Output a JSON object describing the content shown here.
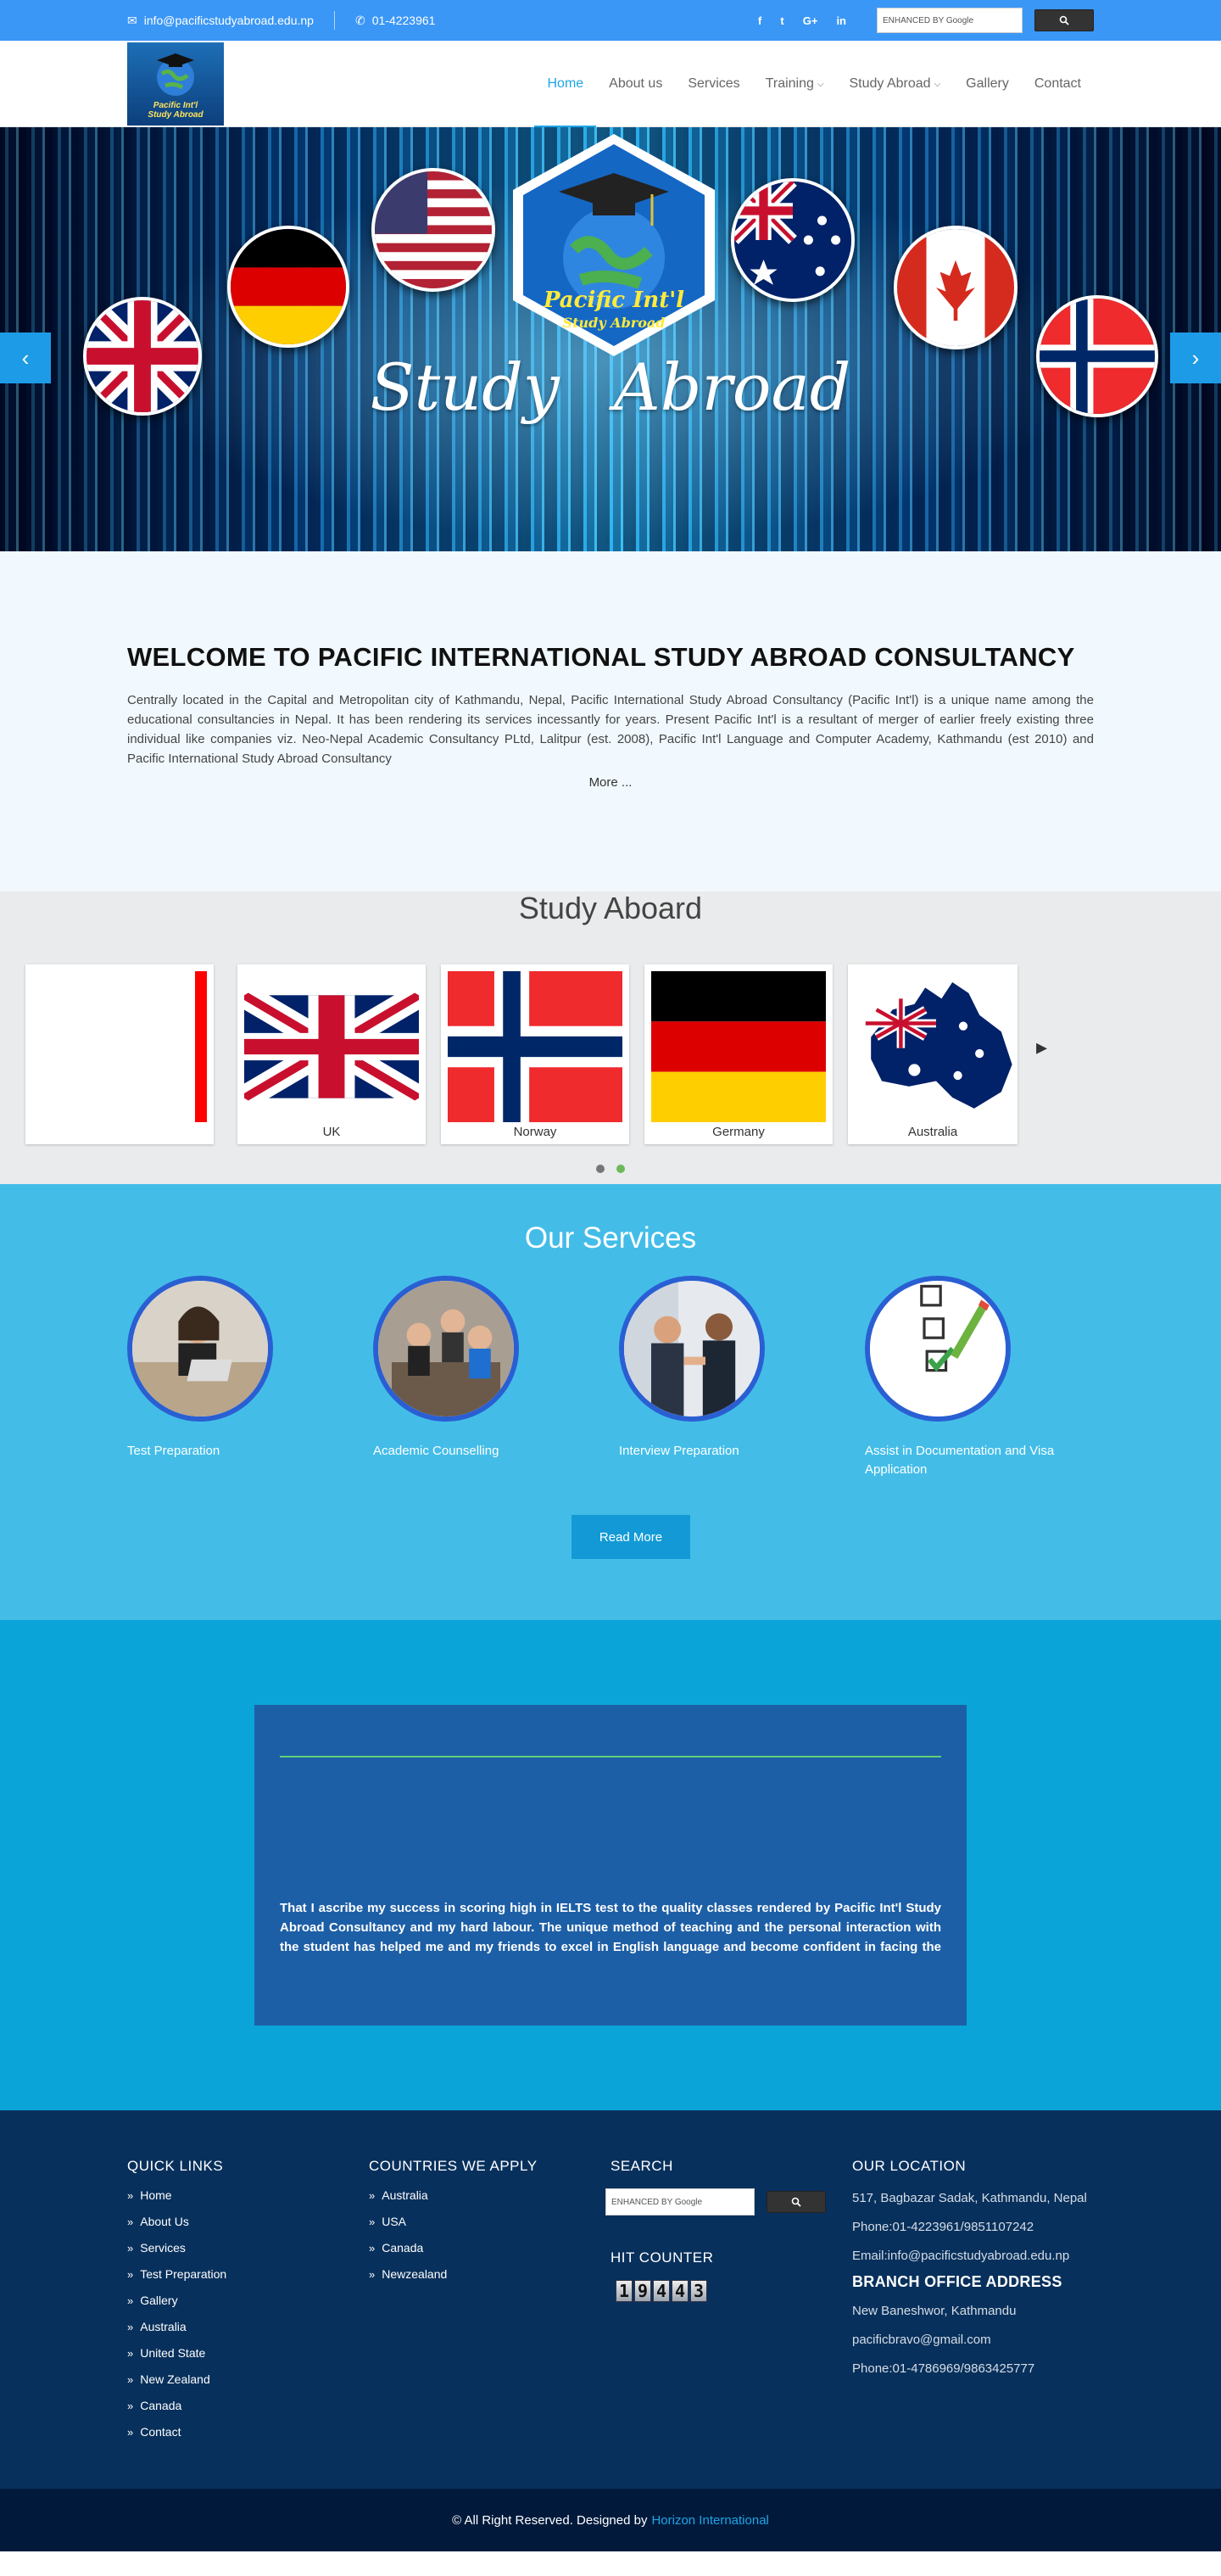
{
  "topbar": {
    "email": "info@pacificstudyabroad.edu.np",
    "phone": "01-4223961",
    "social": [
      "f",
      "t",
      "G+",
      "in"
    ],
    "search_placeholder": "ENHANCED BY Google"
  },
  "brand": {
    "name": "Pacific Int'l",
    "tagline": "Study Abroad"
  },
  "nav": {
    "items": [
      {
        "label": "Home",
        "active": true
      },
      {
        "label": "About us"
      },
      {
        "label": "Services"
      },
      {
        "label": "Training",
        "dropdown": true
      },
      {
        "label": "Study Abroad",
        "dropdown": true
      },
      {
        "label": "Gallery"
      },
      {
        "label": "Contact"
      }
    ]
  },
  "hero": {
    "title": "Study Abroad",
    "logo_line1": "Pacific Int'l",
    "logo_line2": "Study Abroad"
  },
  "welcome": {
    "title": "WELCOME TO PACIFIC INTERNATIONAL STUDY ABROAD CONSULTANCY",
    "body": "Centrally located in the Capital and Metropolitan city of Kathmandu, Nepal, Pacific International Study Abroad Consultancy (Pacific Int'l) is a unique name among the educational consultancies in Nepal. It has been rendering its services incessantly for years. Present Pacific Int'l is a resultant of merger of earlier freely existing three individual like companies viz. Neo-Nepal Academic Consultancy PLtd, Lalitpur (est. 2008), Pacific Int'l Language and Computer Academy, Kathmandu (est 2010) and Pacific International Study Abroad Consultancy",
    "more": "More ..."
  },
  "aboard": {
    "title": "Study Aboard",
    "cards": [
      {
        "label": "UK"
      },
      {
        "label": "Norway"
      },
      {
        "label": "Germany"
      },
      {
        "label": "Australia"
      }
    ]
  },
  "services": {
    "title": "Our Services",
    "items": [
      {
        "label": "Test Preparation"
      },
      {
        "label": "Academic Counselling"
      },
      {
        "label": "Interview Preparation"
      },
      {
        "label": "Assist in Documentation and Visa Application"
      }
    ],
    "button": "Read More"
  },
  "testimonial": {
    "text": "That I ascribe my success in scoring high in IELTS test to the quality classes rendered by Pacific Int'l Study Abroad Consultancy and my hard labour. The unique method of teaching and the personal interaction with the student has helped me and my friends to excel in English language and become confident in facing the Exam. The insightful feedback on all our exercises was an encouraging factor. I am proud to say that I"
  },
  "footer": {
    "quick_links_title": "QUICK LINKS",
    "quick_links": [
      "Home",
      "About Us",
      "Services",
      "Test Preparation",
      "Gallery",
      "Australia",
      "United State",
      "New Zealand",
      "Canada",
      "Contact"
    ],
    "countries_title": "COUNTRIES WE APPLY",
    "countries": [
      "Australia",
      "USA",
      "Canada",
      "Newzealand"
    ],
    "search_title": "SEARCH",
    "counter_title": "HIT COUNTER",
    "counter_digits": [
      "1",
      "9",
      "4",
      "4",
      "3"
    ],
    "location_title": "OUR LOCATION",
    "address": "517, Bagbazar Sadak, Kathmandu, Nepal",
    "phone": "Phone:01-4223961/9851107242",
    "email": "Email:info@pacificstudyabroad.edu.np",
    "branch_title": "BRANCH OFFICE ADDRESS",
    "branch_address": "New Baneshwor, Kathmandu",
    "branch_email": "pacificbravo@gmail.com",
    "branch_phone": "Phone:01-4786969/9863425777"
  },
  "bottom": {
    "copyright": "© All Right Reserved. Designed by",
    "designer": "Horizon International"
  },
  "colors": {
    "topbar": "#3a97f6",
    "accent": "#1ea5e6",
    "services_bg": "#43bde8",
    "testimonial_bg": "#0aa4d8",
    "footer_bg": "#08305c",
    "bottom_bg": "#011a3c"
  }
}
